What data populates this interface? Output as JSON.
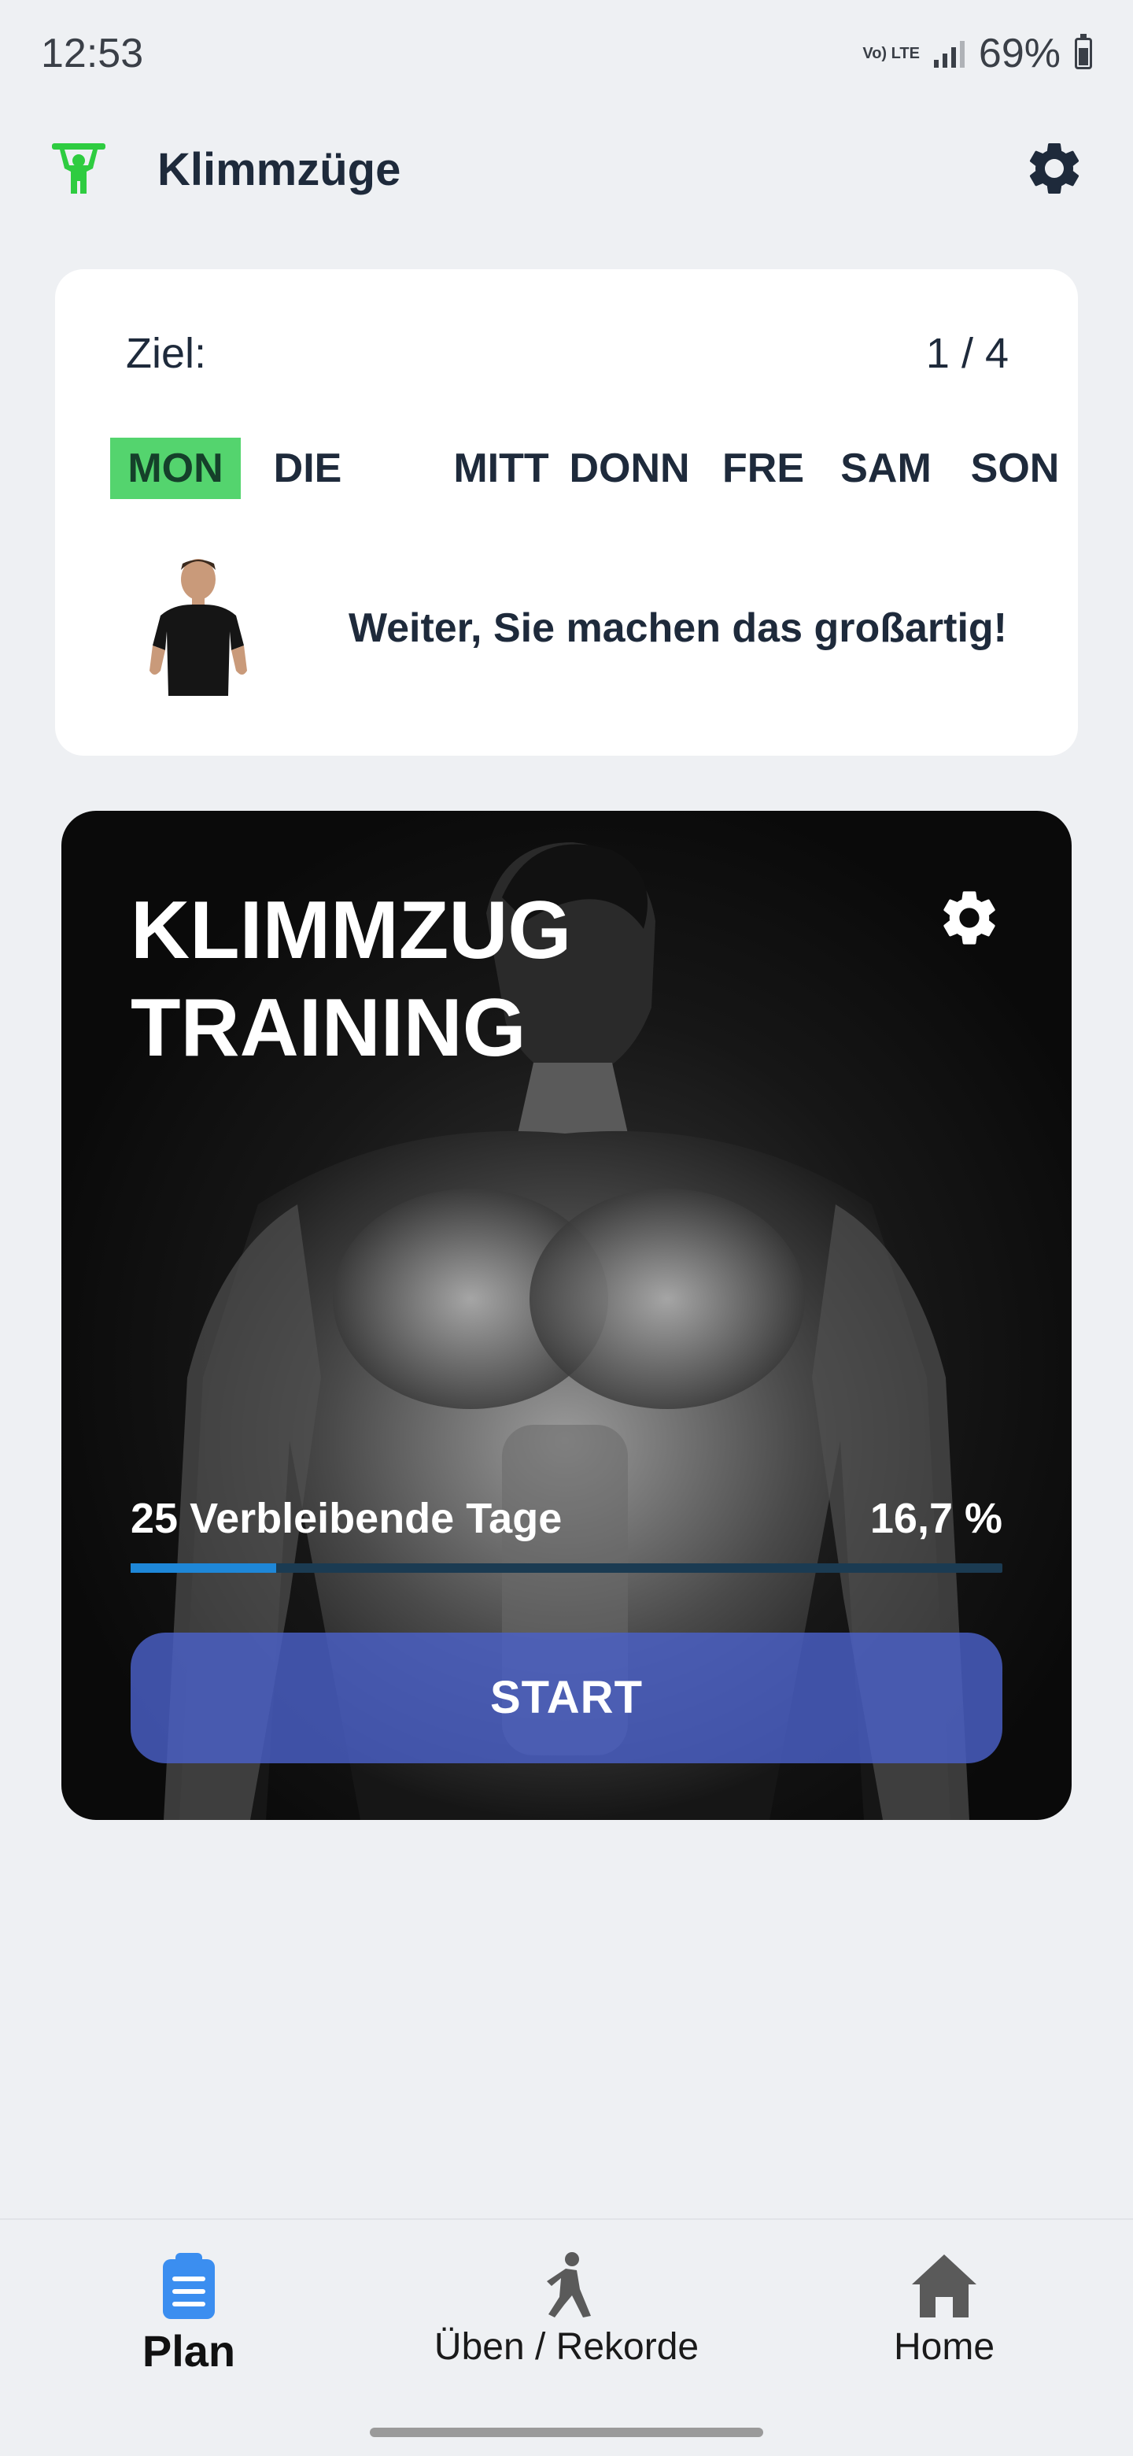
{
  "status_bar": {
    "time": "12:53",
    "network_label": "Vo) LTE",
    "battery": "69%"
  },
  "app_bar": {
    "title": "Klimmzüge",
    "logo_icon": "pullup-figure-icon",
    "settings_icon": "gear-icon"
  },
  "goal": {
    "label": "Ziel:",
    "count": "1 / 4",
    "days": [
      {
        "label": "MON",
        "active": true
      },
      {
        "label": "DIE",
        "active": false
      },
      {
        "label": "MITT",
        "active": false
      },
      {
        "label": "DONN",
        "active": false
      },
      {
        "label": "FRE",
        "active": false
      },
      {
        "label": "SAM",
        "active": false
      },
      {
        "label": "SON",
        "active": false
      }
    ],
    "motivation": "Weiter, Sie machen das großartig!"
  },
  "training": {
    "title_line1": "KLIMMZUG",
    "title_line2": "TRAINING",
    "remaining": "25 Verbleibende Tage",
    "percent": "16,7 %",
    "progress": 0.167,
    "start_label": "START"
  },
  "nav": {
    "items": [
      {
        "label": "Plan",
        "icon": "clipboard-icon",
        "active": true
      },
      {
        "label": "Üben / Rekorde",
        "icon": "stretch-figure-icon",
        "active": false
      },
      {
        "label": "Home",
        "icon": "home-icon",
        "active": false
      }
    ]
  },
  "colors": {
    "accent_green": "#54d46e",
    "progress_blue": "#1e87d8",
    "start_button": "#4b60c8",
    "nav_active": "#3b8ef0"
  }
}
